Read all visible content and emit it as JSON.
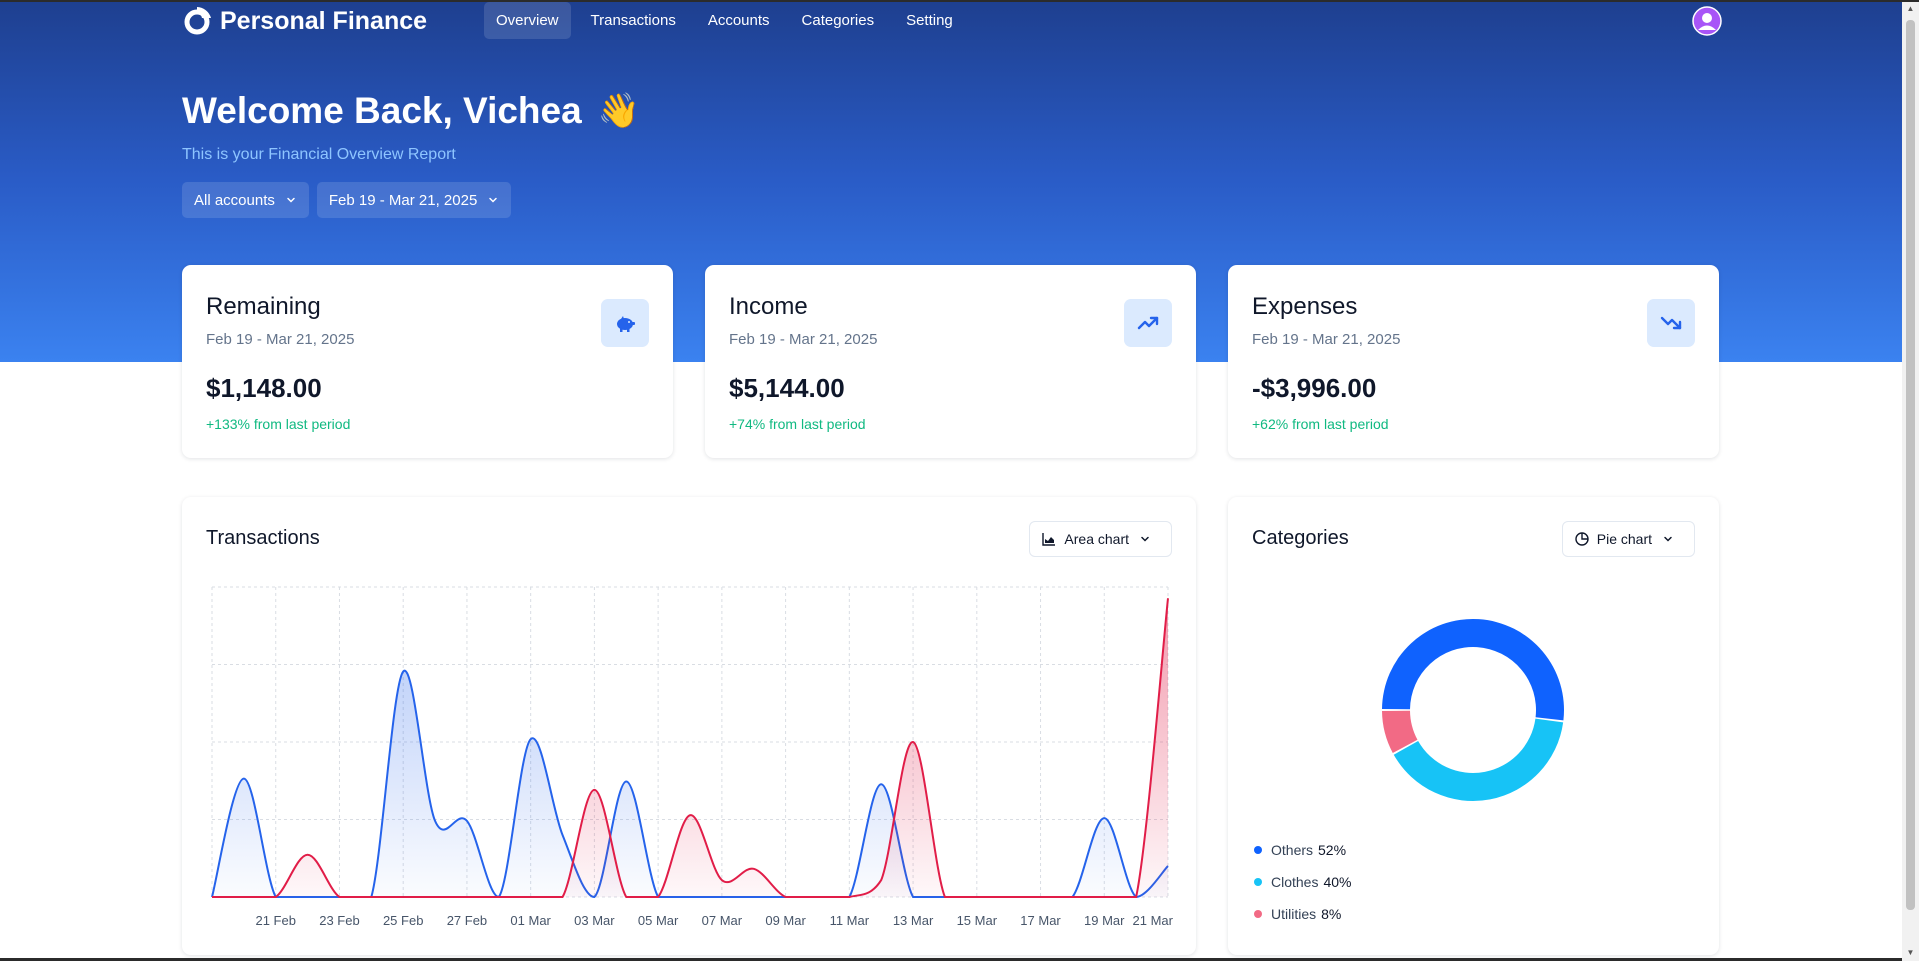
{
  "app": {
    "name": "Personal Finance"
  },
  "nav": {
    "items": [
      {
        "label": "Overview",
        "active": true
      },
      {
        "label": "Transactions",
        "active": false
      },
      {
        "label": "Accounts",
        "active": false
      },
      {
        "label": "Categories",
        "active": false
      },
      {
        "label": "Setting",
        "active": false
      }
    ],
    "avatar_icon": "user-avatar-icon"
  },
  "header": {
    "welcome": "Welcome Back, Vichea",
    "wave_emoji": "👋",
    "subtitle": "This is your Financial Overview Report",
    "account_filter": "All accounts",
    "date_filter": "Feb 19 - Mar 21, 2025"
  },
  "stats": [
    {
      "title": "Remaining",
      "range": "Feb 19 - Mar 21, 2025",
      "value": "$1,148.00",
      "change": "+133% from last period",
      "icon": "piggy-bank-icon"
    },
    {
      "title": "Income",
      "range": "Feb 19 - Mar 21, 2025",
      "value": "$5,144.00",
      "change": "+74% from last period",
      "icon": "trending-up-icon"
    },
    {
      "title": "Expenses",
      "range": "Feb 19 - Mar 21, 2025",
      "value": "-$3,996.00",
      "change": "+62% from last period",
      "icon": "trending-down-icon"
    }
  ],
  "transactions": {
    "title": "Transactions",
    "chart_select": "Area chart"
  },
  "categories": {
    "title": "Categories",
    "chart_select": "Pie chart",
    "legend": [
      {
        "name": "Others",
        "pct": "52%"
      },
      {
        "name": "Clothes",
        "pct": "40%"
      },
      {
        "name": "Utilities",
        "pct": "8%"
      }
    ]
  },
  "colors": {
    "income": "#2563eb",
    "expense": "#e11d48",
    "others": "#0f62fe",
    "clothes": "#17c3f6",
    "utilities": "#f26a85",
    "positive": "#10b981"
  },
  "chart_data": [
    {
      "type": "area",
      "title": "Transactions",
      "tick_labels": [
        "21 Feb",
        "23 Feb",
        "25 Feb",
        "27 Feb",
        "01 Mar",
        "03 Mar",
        "05 Mar",
        "07 Mar",
        "09 Mar",
        "11 Mar",
        "13 Mar",
        "15 Mar",
        "17 Mar",
        "19 Mar",
        "21 Mar"
      ],
      "x": [
        "19 Feb",
        "20 Feb",
        "21 Feb",
        "22 Feb",
        "23 Feb",
        "24 Feb",
        "25 Feb",
        "26 Feb",
        "27 Feb",
        "28 Feb",
        "01 Mar",
        "02 Mar",
        "03 Mar",
        "04 Mar",
        "05 Mar",
        "06 Mar",
        "07 Mar",
        "08 Mar",
        "09 Mar",
        "10 Mar",
        "11 Mar",
        "12 Mar",
        "13 Mar",
        "14 Mar",
        "15 Mar",
        "16 Mar",
        "17 Mar",
        "18 Mar",
        "19 Mar",
        "20 Mar",
        "21 Mar"
      ],
      "series": [
        {
          "values": [
            0,
            420,
            0,
            0,
            0,
            0,
            800,
            270,
            270,
            0,
            560,
            220,
            0,
            410,
            0,
            0,
            0,
            0,
            0,
            0,
            0,
            400,
            0,
            0,
            0,
            0,
            0,
            0,
            280,
            0,
            110
          ]
        },
        {
          "values": [
            0,
            0,
            0,
            150,
            0,
            0,
            0,
            0,
            0,
            0,
            0,
            0,
            380,
            0,
            0,
            290,
            60,
            100,
            0,
            0,
            0,
            60,
            550,
            0,
            0,
            0,
            0,
            0,
            0,
            0,
            1060
          ]
        }
      ],
      "grid": true
    },
    {
      "type": "pie",
      "title": "Categories",
      "categories": [
        "Others",
        "Clothes",
        "Utilities"
      ],
      "values": [
        52,
        40,
        8
      ]
    }
  ]
}
